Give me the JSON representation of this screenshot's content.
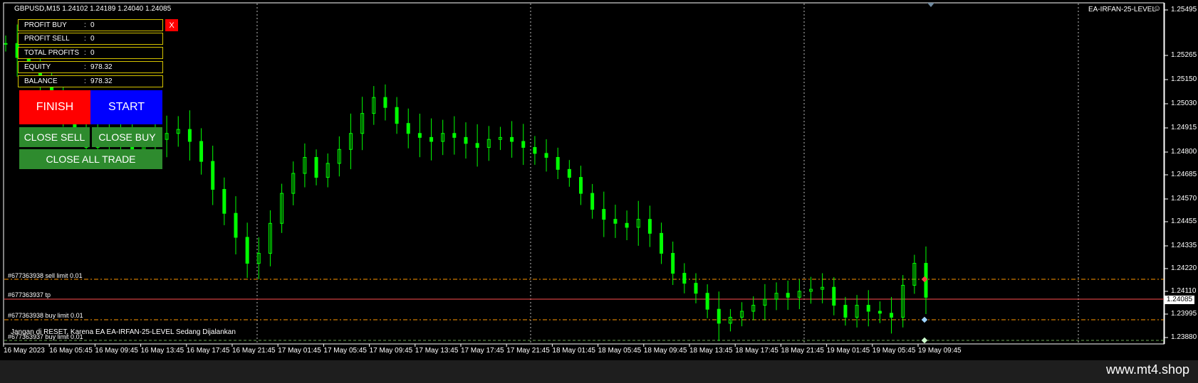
{
  "symbol_header": "GBPUSD,M15  1.24102 1.24189 1.24040 1.24085",
  "ea_name": "EA-IRFAN-25-LEVEL",
  "ea_face_icon": "smiley-icon",
  "current_price": "1.24085",
  "panel": {
    "rows": [
      {
        "label": "PROFIT BUY",
        "sep": ":",
        "value": "0"
      },
      {
        "label": "PROFIT SELL",
        "sep": ":",
        "value": "0"
      },
      {
        "label": "TOTAL PROFITS",
        "sep": ":",
        "value": "0"
      },
      {
        "label": "EQUITY",
        "sep": ":",
        "value": "978.32"
      },
      {
        "label": "BALANCE",
        "sep": ":",
        "value": "978.32"
      }
    ],
    "close_x": "X",
    "finish": "FINISH",
    "start": "START",
    "close_sell": "CLOSE SELL",
    "close_buy": "CLOSE BUY",
    "close_all": "CLOSE ALL TRADE"
  },
  "orders": {
    "sell_limit": "#677363938 sell limit 0.01",
    "tp": "#677363937 tp",
    "buy_limit": "#677363938 buy limit 0.01",
    "buy_limit_2": "#677363937 buy limit 0.01"
  },
  "notice": "Jangan di RESET, Karena EA EA-IRFAN-25-LEVEL Sedang Dijalankan",
  "price_axis": [
    "1.25495",
    "1.25265",
    "1.25150",
    "1.25030",
    "1.24915",
    "1.24800",
    "1.24685",
    "1.24570",
    "1.24455",
    "1.24335",
    "1.24220",
    "1.24110",
    "1.23995",
    "1.23880"
  ],
  "time_axis": [
    "16 May 2023",
    "16 May 05:45",
    "16 May 09:45",
    "16 May 13:45",
    "16 May 17:45",
    "16 May 21:45",
    "17 May 01:45",
    "17 May 05:45",
    "17 May 09:45",
    "17 May 13:45",
    "17 May 17:45",
    "17 May 21:45",
    "18 May 01:45",
    "18 May 05:45",
    "18 May 09:45",
    "18 May 13:45",
    "18 May 17:45",
    "18 May 21:45",
    "19 May 01:45",
    "19 May 05:45",
    "19 May 09:45"
  ],
  "watermark": "www.mt4.shop",
  "colors": {
    "candles": "#00ff00",
    "sell_limit_line": "#ff9900",
    "tp_line": "#ff5050",
    "buy_limit_line": "#ff9900",
    "panel_border": "#d4c200",
    "finish": "#ff0000",
    "start": "#0000ff",
    "close": "#2e8b2e"
  },
  "chart_data": {
    "type": "line",
    "series": [
      {
        "values": [
          1.2535,
          1.2528,
          1.2525,
          1.2515,
          1.2508,
          1.25,
          1.2492,
          1.2483,
          1.249,
          1.2484,
          1.2486,
          1.2482,
          1.2484,
          1.2487,
          1.249,
          1.2492,
          1.2486,
          1.2476,
          1.2462,
          1.245,
          1.2438,
          1.2425,
          1.243,
          1.2445,
          1.246,
          1.247,
          1.2478,
          1.2468,
          1.2475,
          1.2482,
          1.249,
          1.25,
          1.2508,
          1.2503,
          1.2495,
          1.249,
          1.2488,
          1.2486,
          1.249,
          1.2488,
          1.2485,
          1.2483,
          1.2487,
          1.2488,
          1.2486,
          1.2483,
          1.248,
          1.2478,
          1.2472,
          1.2468,
          1.246,
          1.2452,
          1.2447,
          1.2445,
          1.2443,
          1.2447,
          1.244,
          1.243,
          1.242,
          1.2415,
          1.241,
          1.2402,
          1.2395,
          1.2398,
          1.2401,
          1.2404,
          1.2407,
          1.241,
          1.2408,
          1.2411,
          1.2412,
          1.2413,
          1.2404,
          1.2398,
          1.2404,
          1.2401,
          1.24,
          1.2398,
          1.2414,
          1.2425,
          1.2408
        ]
      }
    ],
    "ylim": [
      1.2385,
      1.2555
    ],
    "grid": true
  }
}
